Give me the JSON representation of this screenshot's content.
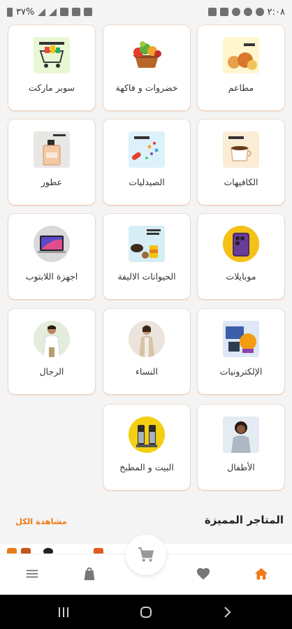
{
  "status_bar": {
    "time": "٢:٠٨",
    "battery": "٣٧%",
    "left_icons": [
      "battery-icon",
      "signal-icon",
      "wifi-icon",
      "mute-icon",
      "alarm-icon"
    ],
    "right_icons": [
      "gallery-icon",
      "sim-icon",
      "messenger-icon",
      "messenger-icon",
      "messenger-icon"
    ]
  },
  "categories": [
    {
      "label": "مطاعم",
      "thumb_text": "مطاعم",
      "icon": "restaurant-thumb"
    },
    {
      "label": "خضروات و فاكهة",
      "thumb_text": "",
      "icon": "vegetables-basket-thumb"
    },
    {
      "label": "سوبر ماركت",
      "thumb_text": "سوبر ماركت",
      "icon": "supermarket-cart-thumb"
    },
    {
      "label": "الكافيهات",
      "thumb_text": "الكافيهات",
      "icon": "cafe-cup-thumb"
    },
    {
      "label": "الصيدليات",
      "thumb_text": "الصيدليات",
      "icon": "pharmacy-pills-thumb"
    },
    {
      "label": "عطور",
      "thumb_text": "",
      "icon": "perfume-bottle-thumb"
    },
    {
      "label": "موبايلات",
      "thumb_text": "موبايلات",
      "icon": "mobile-phone-thumb"
    },
    {
      "label": "الحيوانات الاليفة",
      "thumb_text": "الحيوانات الأليفة",
      "icon": "pets-food-thumb"
    },
    {
      "label": "اجهزة اللابتوب",
      "thumb_text": "",
      "icon": "laptop-thumb"
    },
    {
      "label": "الإلكترونيات",
      "thumb_text": "",
      "icon": "electronics-thumb"
    },
    {
      "label": "النساء",
      "thumb_text": "",
      "icon": "women-fashion-thumb"
    },
    {
      "label": "الرجال",
      "thumb_text": "",
      "icon": "men-fashion-thumb"
    },
    {
      "label": "الأطفال",
      "thumb_text": "",
      "icon": "kids-fashion-thumb"
    },
    {
      "label": "البيت و المطبخ",
      "thumb_text": "",
      "icon": "home-kitchen-thumb"
    }
  ],
  "featured": {
    "title": "المتاجر المميزة",
    "see_all": "مشاهدة الكل"
  },
  "bottom_nav": {
    "items": [
      "home-icon",
      "favorites-heart-icon",
      "cart-icon",
      "bag-icon",
      "menu-icon"
    ],
    "active": "home-icon"
  },
  "colors": {
    "accent": "#f07a16",
    "background": "#f4f4f4",
    "card": "#ffffff",
    "icon_inactive": "#777777"
  }
}
